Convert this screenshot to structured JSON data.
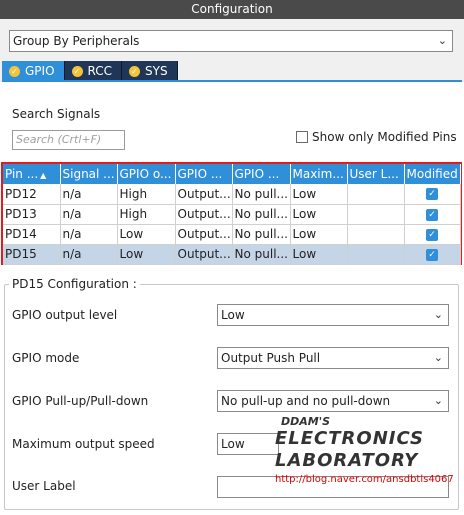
{
  "window": {
    "title": "Configuration"
  },
  "groupby": {
    "value": "Group By Peripherals"
  },
  "tabs": [
    {
      "label": "GPIO",
      "active": true
    },
    {
      "label": "RCC",
      "active": false
    },
    {
      "label": "SYS",
      "active": false
    }
  ],
  "search": {
    "title": "Search Signals",
    "placeholder": "Search (Crtl+F)",
    "only_modified_label": "Show only Modified Pins"
  },
  "table": {
    "headers": [
      "Pin ...",
      "Signal ...",
      "GPIO o...",
      "GPIO ...",
      "GPIO ...",
      "Maxim...",
      "User L...",
      "Modified"
    ],
    "rows": [
      {
        "pin": "PD12",
        "signal": "n/a",
        "level": "High",
        "mode": "Output...",
        "pull": "No pull...",
        "speed": "Low",
        "user_label": "",
        "modified": true,
        "selected": false
      },
      {
        "pin": "PD13",
        "signal": "n/a",
        "level": "High",
        "mode": "Output...",
        "pull": "No pull...",
        "speed": "Low",
        "user_label": "",
        "modified": true,
        "selected": false
      },
      {
        "pin": "PD14",
        "signal": "n/a",
        "level": "Low",
        "mode": "Output...",
        "pull": "No pull...",
        "speed": "Low",
        "user_label": "",
        "modified": true,
        "selected": false
      },
      {
        "pin": "PD15",
        "signal": "n/a",
        "level": "Low",
        "mode": "Output...",
        "pull": "No pull...",
        "speed": "Low",
        "user_label": "",
        "modified": true,
        "selected": true
      }
    ]
  },
  "config": {
    "title": "PD15 Configuration :",
    "fields": [
      {
        "label": "GPIO output level",
        "value": "Low"
      },
      {
        "label": "GPIO mode",
        "value": "Output Push Pull"
      },
      {
        "label": "GPIO Pull-up/Pull-down",
        "value": "No pull-up and no pull-down"
      },
      {
        "label": "Maximum output speed",
        "value": "Low"
      },
      {
        "label": "User Label",
        "value": ""
      }
    ]
  },
  "watermark": {
    "line1": "DDAM'S",
    "line2": "ELECTRONICS",
    "line3": "LABORATORY",
    "url": "http://blog.naver.com/ansdbtls4067"
  },
  "colors": {
    "accent": "#2f8fd8",
    "tab_dark": "#1f3659",
    "highlight_border": "#e31b1b",
    "selected_row": "#c5d5e8"
  }
}
